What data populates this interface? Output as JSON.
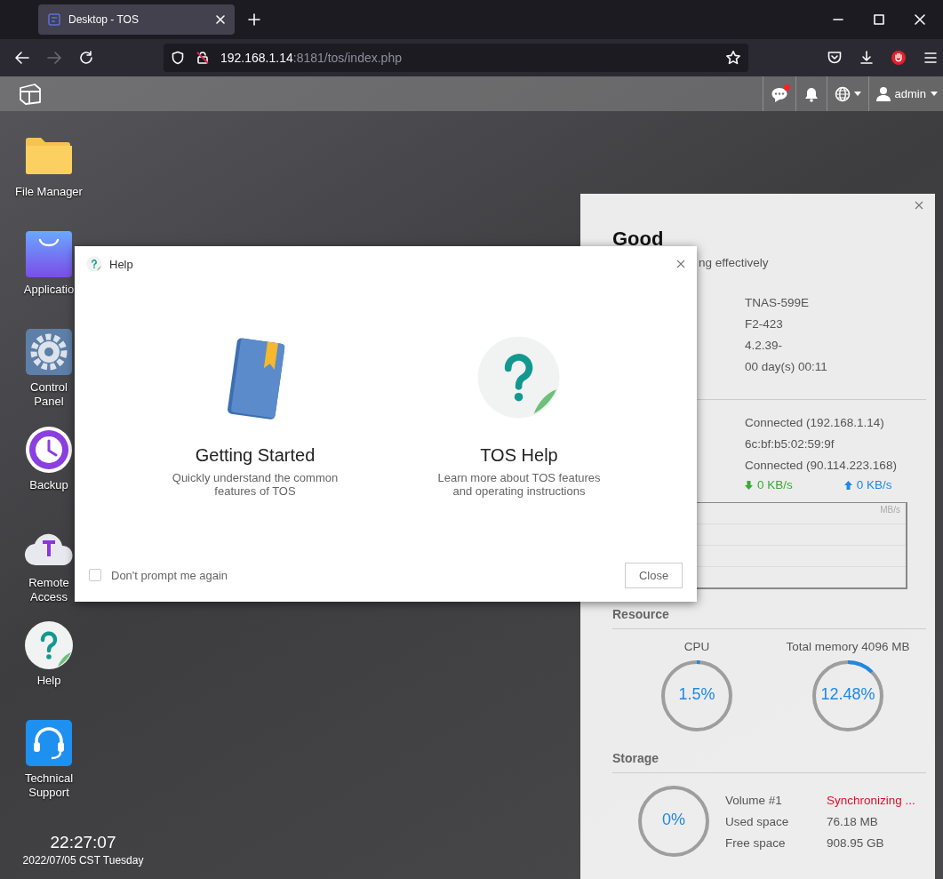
{
  "browser": {
    "tabs": [
      {
        "title": "Desktop - TOS",
        "selected": true
      }
    ],
    "url": {
      "host": "192.168.1.14",
      "rest": ":8181/tos/index.php"
    },
    "forward_disabled": true
  },
  "top_bar": {
    "chat_unread": true,
    "user": "admin"
  },
  "desktop_icons": [
    {
      "kind": "folder",
      "label": "File Manager"
    },
    {
      "kind": "bag",
      "label": "Applicatio"
    },
    {
      "kind": "gear",
      "label": "Control\nPanel"
    },
    {
      "kind": "backup",
      "label": "Backup"
    },
    {
      "kind": "cloud",
      "label": "Remote\nAccess"
    },
    {
      "kind": "help",
      "label": "Help"
    },
    {
      "kind": "headset",
      "label": "Technical\nSupport"
    }
  ],
  "clock": {
    "time": "22:27:07",
    "date": "2022/07/05 CST Tuesday"
  },
  "dashboard": {
    "status": "Good",
    "status_note": "ng effectively",
    "system_values": [
      "TNAS-599E",
      "F2-423",
      "4.2.39-",
      "00 day(s) 00:11"
    ],
    "network_values": [
      "Connected (192.168.1.14)",
      "6c:bf:b5:02:59:9f",
      "Connected (90.114.223.168)"
    ],
    "download": "0 KB/s",
    "upload": "0 KB/s",
    "chart_unit": "MB/s",
    "resource": {
      "title": "Resource",
      "gauges": [
        {
          "label": "CPU",
          "reading": "1.5%",
          "level": 0.015
        },
        {
          "label": "Total memory 4096 MB",
          "reading": "12.48%",
          "level": 0.1248
        }
      ]
    },
    "storage": {
      "title": "Storage",
      "gauge": {
        "reading": "0%",
        "level": 0
      },
      "rows": [
        {
          "label": "Volume #1",
          "value": "Synchronizing ...",
          "alert": true
        },
        {
          "label": "Used space",
          "value": "76.18 MB",
          "alert": false
        },
        {
          "label": "Free space",
          "value": "908.95 GB",
          "alert": false
        }
      ]
    }
  },
  "help_dialog": {
    "title": "Help",
    "items": [
      {
        "kind": "book",
        "title": "Getting Started",
        "description": "Quickly understand the common\nfeatures of TOS"
      },
      {
        "kind": "help",
        "title": "TOS Help",
        "description": "Learn more about TOS features\nand operating instructions"
      }
    ],
    "dont_prompt": {
      "label": "Don't prompt me again",
      "checked": false
    },
    "close_button": "Close"
  }
}
